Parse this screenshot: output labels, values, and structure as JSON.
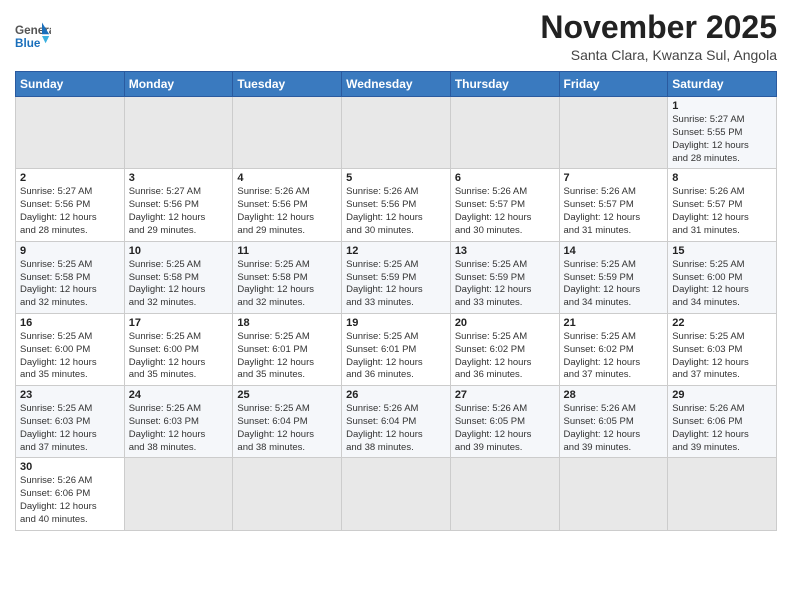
{
  "header": {
    "logo_general": "General",
    "logo_blue": "Blue",
    "month_title": "November 2025",
    "location": "Santa Clara, Kwanza Sul, Angola"
  },
  "weekdays": [
    "Sunday",
    "Monday",
    "Tuesday",
    "Wednesday",
    "Thursday",
    "Friday",
    "Saturday"
  ],
  "weeks": [
    [
      {
        "day": "",
        "empty": true
      },
      {
        "day": "",
        "empty": true
      },
      {
        "day": "",
        "empty": true
      },
      {
        "day": "",
        "empty": true
      },
      {
        "day": "",
        "empty": true
      },
      {
        "day": "",
        "empty": true
      },
      {
        "day": "1",
        "sunrise": "5:27 AM",
        "sunset": "5:55 PM",
        "hours": "12",
        "minutes": "28"
      }
    ],
    [
      {
        "day": "2",
        "sunrise": "5:27 AM",
        "sunset": "5:56 PM",
        "hours": "12",
        "minutes": "28"
      },
      {
        "day": "3",
        "sunrise": "5:27 AM",
        "sunset": "5:56 PM",
        "hours": "12",
        "minutes": "29"
      },
      {
        "day": "4",
        "sunrise": "5:26 AM",
        "sunset": "5:56 PM",
        "hours": "12",
        "minutes": "29"
      },
      {
        "day": "5",
        "sunrise": "5:26 AM",
        "sunset": "5:56 PM",
        "hours": "12",
        "minutes": "30"
      },
      {
        "day": "6",
        "sunrise": "5:26 AM",
        "sunset": "5:57 PM",
        "hours": "12",
        "minutes": "30"
      },
      {
        "day": "7",
        "sunrise": "5:26 AM",
        "sunset": "5:57 PM",
        "hours": "12",
        "minutes": "31"
      },
      {
        "day": "8",
        "sunrise": "5:26 AM",
        "sunset": "5:57 PM",
        "hours": "12",
        "minutes": "31"
      }
    ],
    [
      {
        "day": "9",
        "sunrise": "5:25 AM",
        "sunset": "5:58 PM",
        "hours": "12",
        "minutes": "32"
      },
      {
        "day": "10",
        "sunrise": "5:25 AM",
        "sunset": "5:58 PM",
        "hours": "12",
        "minutes": "32"
      },
      {
        "day": "11",
        "sunrise": "5:25 AM",
        "sunset": "5:58 PM",
        "hours": "12",
        "minutes": "32"
      },
      {
        "day": "12",
        "sunrise": "5:25 AM",
        "sunset": "5:59 PM",
        "hours": "12",
        "minutes": "33"
      },
      {
        "day": "13",
        "sunrise": "5:25 AM",
        "sunset": "5:59 PM",
        "hours": "12",
        "minutes": "33"
      },
      {
        "day": "14",
        "sunrise": "5:25 AM",
        "sunset": "5:59 PM",
        "hours": "12",
        "minutes": "34"
      },
      {
        "day": "15",
        "sunrise": "5:25 AM",
        "sunset": "6:00 PM",
        "hours": "12",
        "minutes": "34"
      }
    ],
    [
      {
        "day": "16",
        "sunrise": "5:25 AM",
        "sunset": "6:00 PM",
        "hours": "12",
        "minutes": "35"
      },
      {
        "day": "17",
        "sunrise": "5:25 AM",
        "sunset": "6:00 PM",
        "hours": "12",
        "minutes": "35"
      },
      {
        "day": "18",
        "sunrise": "5:25 AM",
        "sunset": "6:01 PM",
        "hours": "12",
        "minutes": "35"
      },
      {
        "day": "19",
        "sunrise": "5:25 AM",
        "sunset": "6:01 PM",
        "hours": "12",
        "minutes": "36"
      },
      {
        "day": "20",
        "sunrise": "5:25 AM",
        "sunset": "6:02 PM",
        "hours": "12",
        "minutes": "36"
      },
      {
        "day": "21",
        "sunrise": "5:25 AM",
        "sunset": "6:02 PM",
        "hours": "12",
        "minutes": "37"
      },
      {
        "day": "22",
        "sunrise": "5:25 AM",
        "sunset": "6:03 PM",
        "hours": "12",
        "minutes": "37"
      }
    ],
    [
      {
        "day": "23",
        "sunrise": "5:25 AM",
        "sunset": "6:03 PM",
        "hours": "12",
        "minutes": "37"
      },
      {
        "day": "24",
        "sunrise": "5:25 AM",
        "sunset": "6:03 PM",
        "hours": "12",
        "minutes": "38"
      },
      {
        "day": "25",
        "sunrise": "5:25 AM",
        "sunset": "6:04 PM",
        "hours": "12",
        "minutes": "38"
      },
      {
        "day": "26",
        "sunrise": "5:26 AM",
        "sunset": "6:04 PM",
        "hours": "12",
        "minutes": "38"
      },
      {
        "day": "27",
        "sunrise": "5:26 AM",
        "sunset": "6:05 PM",
        "hours": "12",
        "minutes": "39"
      },
      {
        "day": "28",
        "sunrise": "5:26 AM",
        "sunset": "6:05 PM",
        "hours": "12",
        "minutes": "39"
      },
      {
        "day": "29",
        "sunrise": "5:26 AM",
        "sunset": "6:06 PM",
        "hours": "12",
        "minutes": "39"
      }
    ],
    [
      {
        "day": "30",
        "sunrise": "5:26 AM",
        "sunset": "6:06 PM",
        "hours": "12",
        "minutes": "40"
      },
      {
        "day": "",
        "empty": true
      },
      {
        "day": "",
        "empty": true
      },
      {
        "day": "",
        "empty": true
      },
      {
        "day": "",
        "empty": true
      },
      {
        "day": "",
        "empty": true
      },
      {
        "day": "",
        "empty": true
      }
    ]
  ]
}
